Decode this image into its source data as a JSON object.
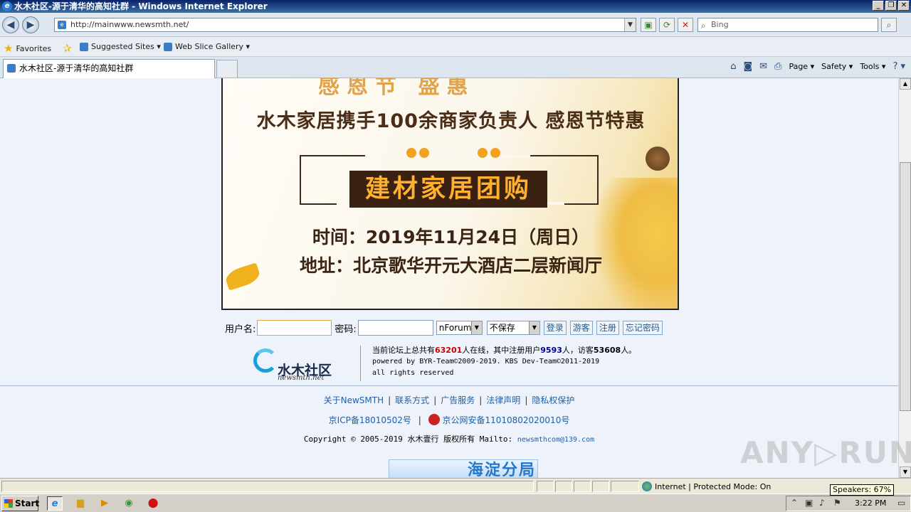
{
  "window": {
    "title": "水木社区-源于清华的高知社群 - Windows Internet Explorer",
    "minimize": "_",
    "restore": "❐",
    "close": "✕"
  },
  "nav": {
    "back": "◀",
    "forward": "▶",
    "url": "http://mainwww.newsmth.net/",
    "search_placeholder": "Bing"
  },
  "favorites": {
    "label": "Favorites",
    "items": [
      "Suggested Sites ▾",
      "Web Slice Gallery ▾"
    ]
  },
  "tab": {
    "label": "水木社区-源于清华的高知社群"
  },
  "commandbar": {
    "page": "Page ▾",
    "safety": "Safety ▾",
    "tools": "Tools ▾",
    "help": "? ▾"
  },
  "banner": {
    "top_partial": "感恩节 盛惠",
    "headline": "水木家居携手100余商家负责人  感恩节特惠",
    "title": "建材家居团购",
    "time": "时间：2019年11月24日（周日）",
    "address": "地址：北京歌华开元大酒店二层新闻厅"
  },
  "login": {
    "username_label": "用户名:",
    "password_label": "密码:",
    "forum_select": "nForum",
    "save_select": "不保存",
    "login_btn": "登录",
    "guest_btn": "游客",
    "register_btn": "注册",
    "forgot_btn": "忘记密码"
  },
  "logo": {
    "name": "水木社区",
    "domain": "newsmth.net"
  },
  "stats": {
    "prefix": "当前论坛上总共有",
    "online": "63201",
    "mid": "人在线，其中注册用户",
    "registered": "9593",
    "mid2": "人，访客",
    "guests": "53608",
    "suffix": "人。",
    "powered": "powered by BYR-Team©2009-2019. KBS Dev-Team©2011-2019",
    "rights": "all rights reserved"
  },
  "footer": {
    "links": [
      "关于NewSMTH",
      "联系方式",
      "广告服务",
      "法律声明",
      "隐私权保护"
    ],
    "icp": "京ICP备18010502号",
    "police": "京公网安备11010802020010号",
    "copyright": "Copyright © 2005-2019 水木壹行 版权所有 Mailto: ",
    "email": "newsmthcom@139.com",
    "ad_text": "海淀分局"
  },
  "status": {
    "zone": "Internet | Protected Mode: On",
    "speakers": "Speakers: 67%"
  },
  "taskbar": {
    "start": "Start",
    "clock": "3:22 PM"
  },
  "watermark": "ANY▷RUN"
}
